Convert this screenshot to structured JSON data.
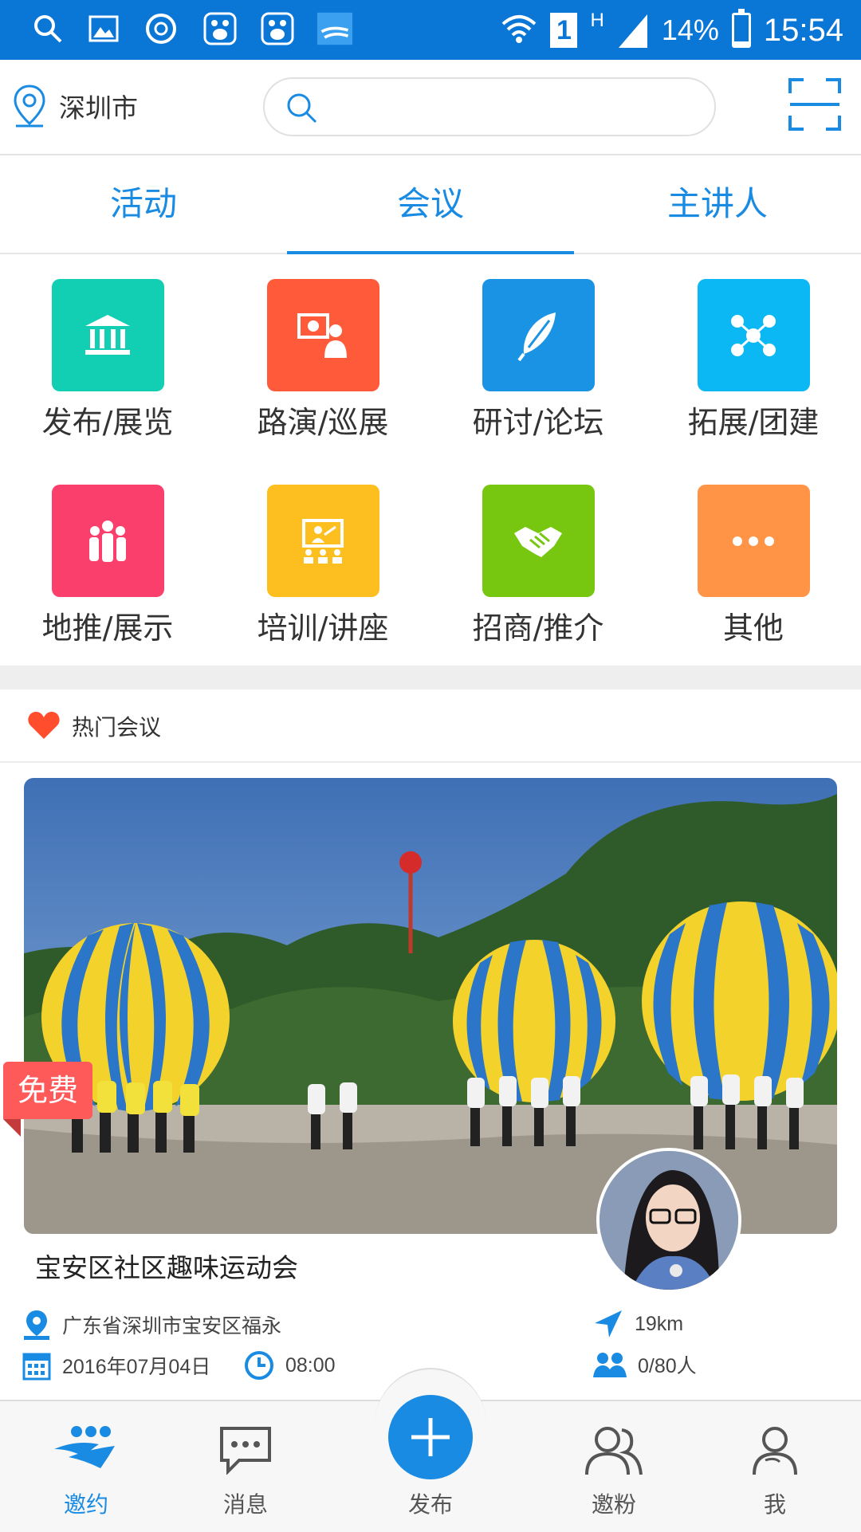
{
  "status_bar": {
    "battery": "14%",
    "time": "15:54",
    "sim_slot": "1",
    "network": "H"
  },
  "header": {
    "city": "深圳市",
    "search_placeholder": ""
  },
  "tabs": [
    {
      "label": "活动",
      "active": false
    },
    {
      "label": "会议",
      "active": true
    },
    {
      "label": "主讲人",
      "active": false
    }
  ],
  "categories": [
    {
      "label": "发布/展览",
      "color": "#12cfb3",
      "icon": "museum-icon"
    },
    {
      "label": "路演/巡展",
      "color": "#ff5b3a",
      "icon": "presenter-icon"
    },
    {
      "label": "研讨/论坛",
      "color": "#1b93e5",
      "icon": "feather-icon"
    },
    {
      "label": "拓展/团建",
      "color": "#0cb8f3",
      "icon": "network-icon"
    },
    {
      "label": "地推/展示",
      "color": "#fb3f6c",
      "icon": "crowd-icon"
    },
    {
      "label": "培训/讲座",
      "color": "#fcbf1f",
      "icon": "lecture-icon"
    },
    {
      "label": "招商/推介",
      "color": "#77c711",
      "icon": "handshake-icon"
    },
    {
      "label": "其他",
      "color": "#ff9447",
      "icon": "more-icon"
    }
  ],
  "hot": {
    "title": "热门会议"
  },
  "card": {
    "badge": "免费",
    "title": "宝安区社区趣味运动会",
    "address": "广东省深圳市宝安区福永",
    "date": "2016年07月04日",
    "time": "08:00",
    "distance": "19km",
    "attendance": "0/80人"
  },
  "nav": [
    {
      "label": "邀约",
      "active": true
    },
    {
      "label": "消息",
      "active": false
    },
    {
      "label": "发布",
      "active": false
    },
    {
      "label": "邀粉",
      "active": false
    },
    {
      "label": "我",
      "active": false
    }
  ],
  "colors": {
    "accent": "#1a8be3",
    "status_bar": "#0a77d6",
    "badge": "#ff5a5a"
  }
}
